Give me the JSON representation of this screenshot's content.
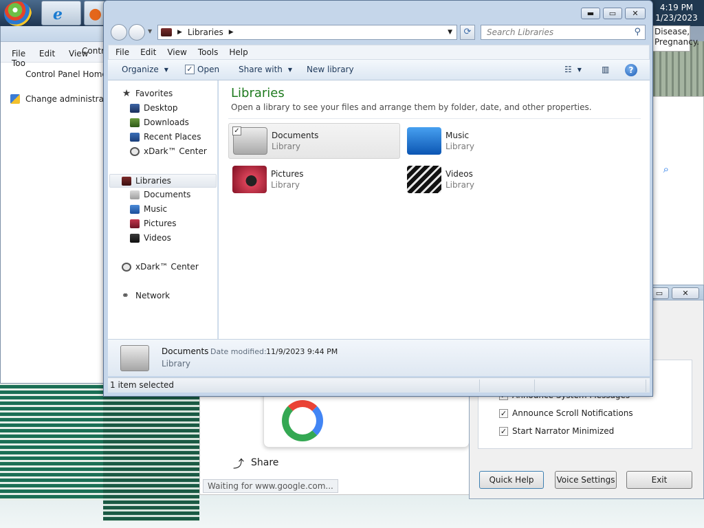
{
  "taskbar": {
    "clock_time": "4:19 PM",
    "clock_date": "1/23/2023",
    "notice_line1": "Disease,",
    "notice_line2": "Pregnancy."
  },
  "bg_control_panel": {
    "address": "Contr",
    "menu": [
      "File",
      "Edit",
      "View",
      "Too"
    ],
    "links": [
      "Control Panel Home",
      "Change administrativ"
    ]
  },
  "bg_chrome": {
    "status": "Waiting for www.google.com...",
    "share_label": "Share"
  },
  "narrator": {
    "checks": [
      {
        "label": "Announce System Messages",
        "checked": true
      },
      {
        "label": "Announce Scroll Notifications",
        "checked": true
      },
      {
        "label": "Start Narrator Minimized",
        "checked": true
      }
    ],
    "buttons": [
      "Quick Help",
      "Voice Settings",
      "Exit"
    ]
  },
  "explorer": {
    "address_path": "Libraries",
    "search_placeholder": "Search Libraries",
    "menu": [
      "File",
      "Edit",
      "View",
      "Tools",
      "Help"
    ],
    "commands": {
      "organize": "Organize",
      "open": "Open",
      "share_with": "Share with",
      "new_library": "New library"
    },
    "nav": {
      "favorites": "Favorites",
      "favorites_items": [
        "Desktop",
        "Downloads",
        "Recent Places",
        "xDark™ Center"
      ],
      "libraries": "Libraries",
      "libraries_items": [
        "Documents",
        "Music",
        "Pictures",
        "Videos"
      ],
      "xdark": "xDark™ Center",
      "network": "Network"
    },
    "content": {
      "title": "Libraries",
      "subtitle": "Open a library to see your files and arrange them by folder, date, and other properties.",
      "tiles": [
        {
          "name": "Documents",
          "kind": "Library",
          "selected": true
        },
        {
          "name": "Music",
          "kind": "Library",
          "selected": false
        },
        {
          "name": "Pictures",
          "kind": "Library",
          "selected": false
        },
        {
          "name": "Videos",
          "kind": "Library",
          "selected": false
        }
      ]
    },
    "details": {
      "name": "Documents",
      "modified_label": "Date modified:",
      "modified_value": "11/9/2023 9:44 PM",
      "kind": "Library"
    },
    "status": "1 item selected"
  },
  "colors": {
    "title_green": "#1e7a1e",
    "window_frame": "#c5d6ea"
  }
}
